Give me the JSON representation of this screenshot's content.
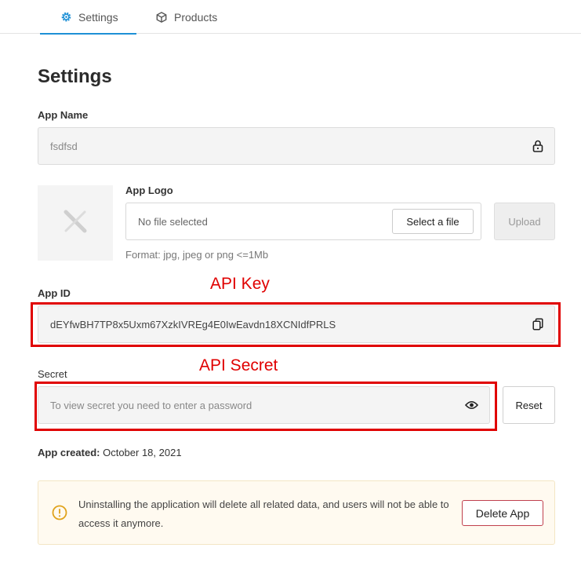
{
  "tabs": [
    {
      "label": "Settings",
      "icon": "gear-icon",
      "active": true
    },
    {
      "label": "Products",
      "icon": "box-icon",
      "active": false
    }
  ],
  "page_title": "Settings",
  "app_name": {
    "label": "App Name",
    "value": "fsdfsd",
    "icon": "lock-icon"
  },
  "app_logo": {
    "label": "App Logo",
    "file_status": "No file selected",
    "select_label": "Select a file",
    "upload_label": "Upload",
    "format_hint": "Format: jpg, jpeg or png <=1Mb"
  },
  "app_id": {
    "label": "App ID",
    "value": "dEYfwBH7TP8x5Uxm67XzkIVREg4E0IwEavdn18XCNIdfPRLS",
    "icon": "copy-icon"
  },
  "secret": {
    "label": "Secret",
    "placeholder": "To view secret you need to enter a password",
    "icon": "eye-icon",
    "reset_label": "Reset"
  },
  "annotations": {
    "api_key": "API Key",
    "api_secret": "API Secret"
  },
  "created": {
    "label": "App created:",
    "value": "October 18, 2021"
  },
  "warning": {
    "text": "Uninstalling the application will delete all related data, and users will not be able to access it anymore.",
    "delete_label": "Delete App",
    "icon": "alert-circle-icon"
  },
  "colors": {
    "accent": "#1e90d6",
    "annotation": "#e00000",
    "warning_bg": "#fffaf0",
    "danger_border": "#c0404e"
  }
}
